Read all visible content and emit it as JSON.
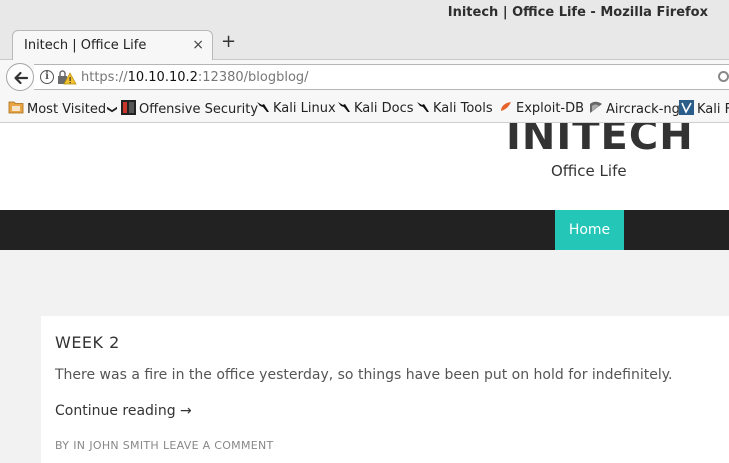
{
  "window": {
    "title": "Initech | Office Life - Mozilla Firefox"
  },
  "tab": {
    "title": "Initech | Office Life",
    "close": "×",
    "new_tab": "+"
  },
  "urlbar": {
    "scheme": "https://",
    "host": "10.10.10.2",
    "rest": ":12380/blogblog/"
  },
  "bookmarks": [
    {
      "label": "Most Visited",
      "icon": "folder-icon",
      "suffix": "❯"
    },
    {
      "label": "Offensive Security",
      "icon": "offsec-icon"
    },
    {
      "label": "Kali Linux",
      "icon": "kali-dragon-icon"
    },
    {
      "label": "Kali Docs",
      "icon": "kali-dragon-icon"
    },
    {
      "label": "Kali Tools",
      "icon": "kali-dragon-icon"
    },
    {
      "label": "Exploit-DB",
      "icon": "exploitdb-icon"
    },
    {
      "label": "Aircrack-ng",
      "icon": "aircrack-icon"
    },
    {
      "label": "Kali F",
      "icon": "kali-forum-icon"
    }
  ],
  "site": {
    "title": "INITECH",
    "description": "Office Life"
  },
  "menu": {
    "home": "Home"
  },
  "post": {
    "title": "WEEK 2",
    "excerpt": "There was a fire in the office yesterday, so things have been put on hold for indefinitely.",
    "read_more": "Continue reading →",
    "meta": {
      "by": "BY",
      "in": "IN",
      "author": "JOHN SMITH",
      "comment": "LEAVE A COMMENT"
    }
  },
  "colors": {
    "accent": "#24c6b8",
    "menubar": "#222222"
  }
}
